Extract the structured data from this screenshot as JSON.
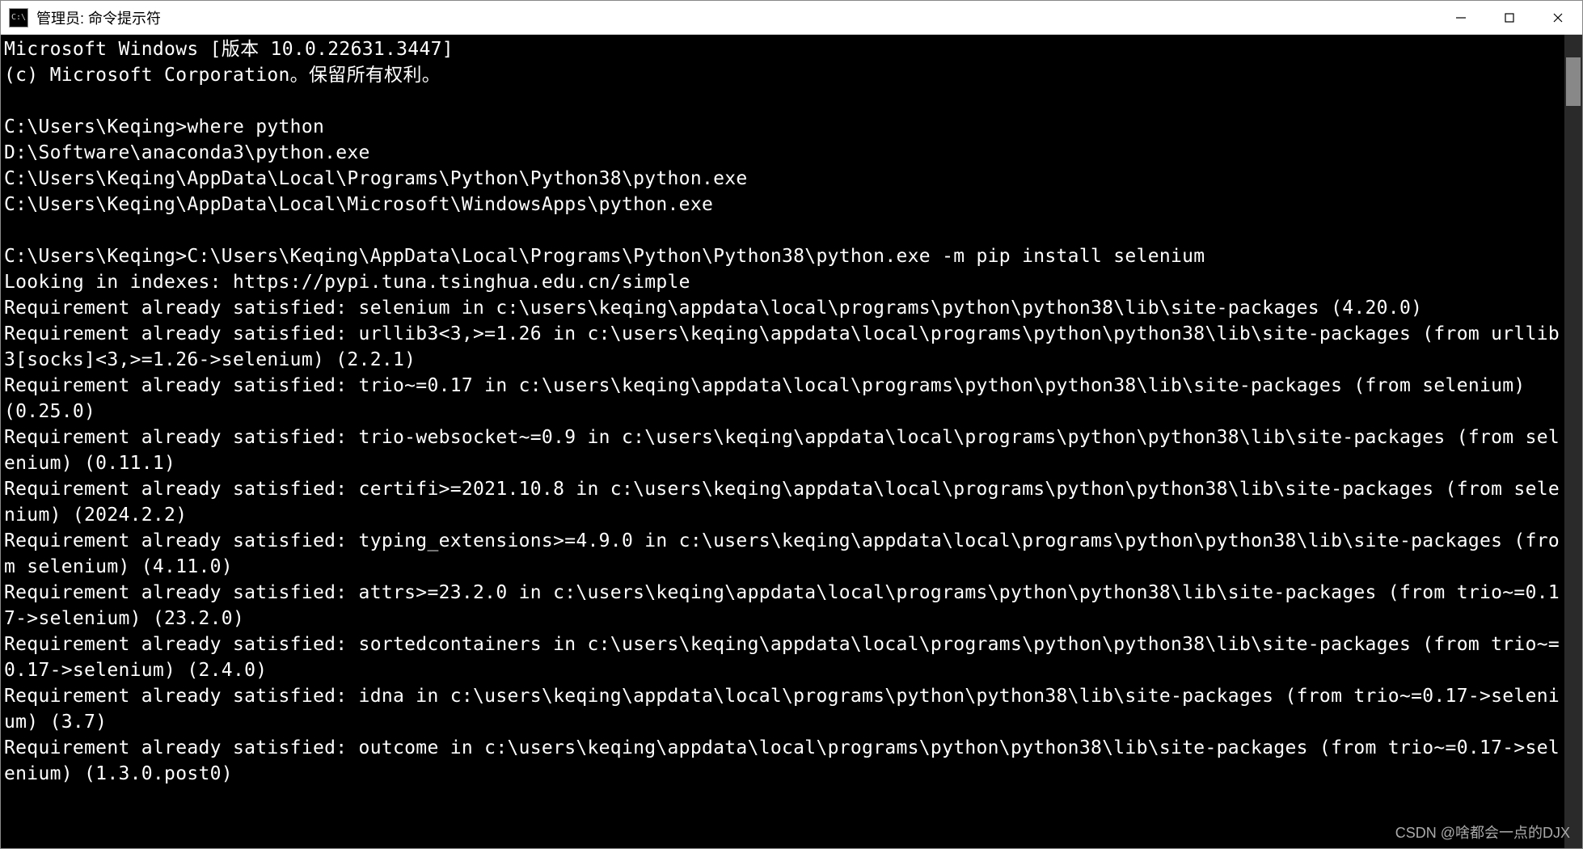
{
  "window": {
    "icon_text": "C:\\",
    "title": "管理员: 命令提示符"
  },
  "terminal": {
    "lines": [
      "Microsoft Windows [版本 10.0.22631.3447]",
      "(c) Microsoft Corporation。保留所有权利。",
      "",
      "C:\\Users\\Keqing>where python",
      "D:\\Software\\anaconda3\\python.exe",
      "C:\\Users\\Keqing\\AppData\\Local\\Programs\\Python\\Python38\\python.exe",
      "C:\\Users\\Keqing\\AppData\\Local\\Microsoft\\WindowsApps\\python.exe",
      "",
      "C:\\Users\\Keqing>C:\\Users\\Keqing\\AppData\\Local\\Programs\\Python\\Python38\\python.exe -m pip install selenium",
      "Looking in indexes: https://pypi.tuna.tsinghua.edu.cn/simple",
      "Requirement already satisfied: selenium in c:\\users\\keqing\\appdata\\local\\programs\\python\\python38\\lib\\site-packages (4.20.0)",
      "Requirement already satisfied: urllib3<3,>=1.26 in c:\\users\\keqing\\appdata\\local\\programs\\python\\python38\\lib\\site-packages (from urllib3[socks]<3,>=1.26->selenium) (2.2.1)",
      "Requirement already satisfied: trio~=0.17 in c:\\users\\keqing\\appdata\\local\\programs\\python\\python38\\lib\\site-packages (from selenium) (0.25.0)",
      "Requirement already satisfied: trio-websocket~=0.9 in c:\\users\\keqing\\appdata\\local\\programs\\python\\python38\\lib\\site-packages (from selenium) (0.11.1)",
      "Requirement already satisfied: certifi>=2021.10.8 in c:\\users\\keqing\\appdata\\local\\programs\\python\\python38\\lib\\site-packages (from selenium) (2024.2.2)",
      "Requirement already satisfied: typing_extensions>=4.9.0 in c:\\users\\keqing\\appdata\\local\\programs\\python\\python38\\lib\\site-packages (from selenium) (4.11.0)",
      "Requirement already satisfied: attrs>=23.2.0 in c:\\users\\keqing\\appdata\\local\\programs\\python\\python38\\lib\\site-packages (from trio~=0.17->selenium) (23.2.0)",
      "Requirement already satisfied: sortedcontainers in c:\\users\\keqing\\appdata\\local\\programs\\python\\python38\\lib\\site-packages (from trio~=0.17->selenium) (2.4.0)",
      "Requirement already satisfied: idna in c:\\users\\keqing\\appdata\\local\\programs\\python\\python38\\lib\\site-packages (from trio~=0.17->selenium) (3.7)",
      "Requirement already satisfied: outcome in c:\\users\\keqing\\appdata\\local\\programs\\python\\python38\\lib\\site-packages (from trio~=0.17->selenium) (1.3.0.post0)"
    ]
  },
  "watermark": "CSDN @啥都会一点的DJX"
}
